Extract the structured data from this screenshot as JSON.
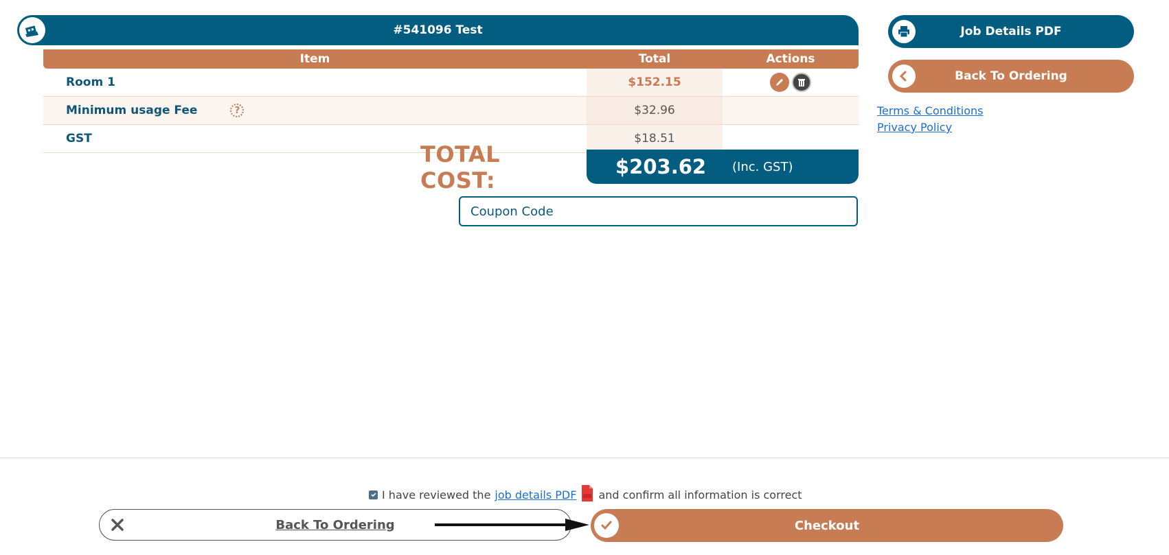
{
  "job": {
    "title": "#541096 Test"
  },
  "table": {
    "headers": {
      "item": "Item",
      "total": "Total",
      "actions": "Actions"
    },
    "rows": [
      {
        "item": "Room 1",
        "total": "$152.15"
      },
      {
        "item": "Minimum usage Fee",
        "total": "$32.96",
        "help": "?"
      },
      {
        "item": "GST",
        "total": "$18.51"
      }
    ]
  },
  "summary": {
    "total_label": "TOTAL COST:",
    "total_value": "$203.62",
    "total_note": "(Inc. GST)"
  },
  "coupon": {
    "placeholder": "Coupon Code"
  },
  "sidebar": {
    "pdf_button": "Job Details PDF",
    "back_button": "Back To Ordering",
    "links": [
      "Terms & Conditions",
      "Privacy Policy"
    ]
  },
  "footer": {
    "confirm_before": "I have reviewed the",
    "confirm_link": "job details PDF",
    "confirm_after": "and confirm all information is correct",
    "back_button": "Back To Ordering",
    "checkout_button": "Checkout"
  },
  "colors": {
    "primary": "#035d80",
    "accent": "#c77c54"
  }
}
